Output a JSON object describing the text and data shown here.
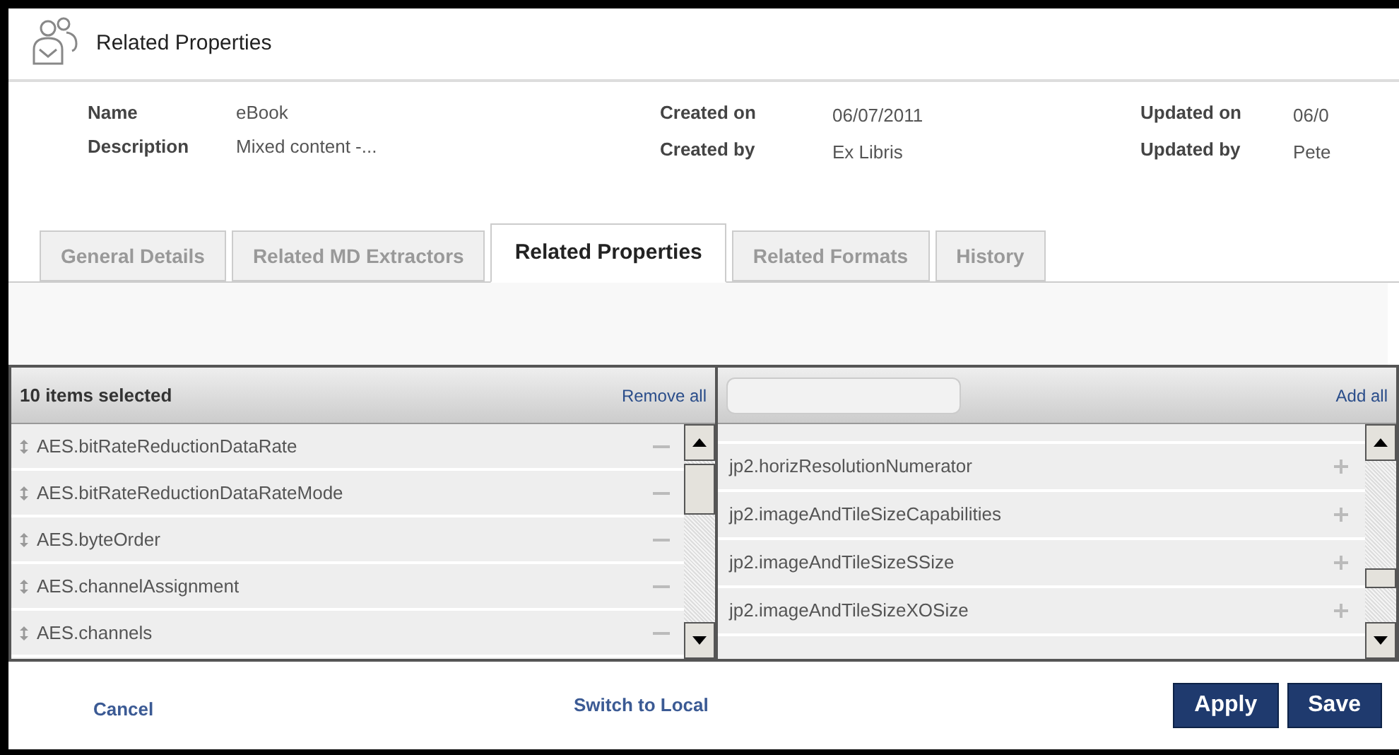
{
  "window": {
    "title": "Related Properties"
  },
  "details": [
    {
      "label": "Name",
      "value": "eBook"
    },
    {
      "label": "Description",
      "value": "Mixed content -..."
    }
  ],
  "created": [
    {
      "label": "Created on",
      "value": "06/07/2011"
    },
    {
      "label": "Created by",
      "value": "Ex Libris"
    }
  ],
  "updated": [
    {
      "label": "Updated on",
      "value": "06/0"
    },
    {
      "label": "Updated by",
      "value": "Pete"
    }
  ],
  "tabs": [
    {
      "label": "General Details",
      "selected": false
    },
    {
      "label": "Related MD Extractors",
      "selected": false
    },
    {
      "label": "Related Properties",
      "selected": true
    },
    {
      "label": "Related Formats",
      "selected": false
    },
    {
      "label": "History",
      "selected": false
    }
  ],
  "selected_list": {
    "title": "10 items selected",
    "action": "Remove all",
    "items": [
      "AES.bitRateReductionDataRate",
      "AES.bitRateReductionDataRateMode",
      "AES.byteOrder",
      "AES.channelAssignment",
      "AES.channels"
    ]
  },
  "available_list": {
    "action": "Add all",
    "items": [
      "jp2.horizResolutionNumerator",
      "jp2.imageAndTileSizeCapabilities",
      "jp2.imageAndTileSizeSSize",
      "jp2.imageAndTileSizeXOSize"
    ]
  },
  "footer": {
    "cancel": "Cancel",
    "switch": "Switch to Local",
    "buttons": [
      "Apply",
      "Save"
    ]
  }
}
